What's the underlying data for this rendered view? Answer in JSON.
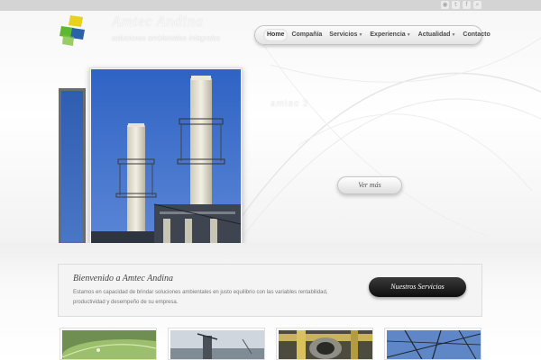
{
  "brand": {
    "name": "Amtec Andina",
    "tagline": "soluciones ambientales integrales"
  },
  "topbar": {
    "icons": [
      "rss-icon",
      "twitter-icon",
      "facebook-icon",
      "search-icon"
    ]
  },
  "nav": {
    "items": [
      {
        "label": "Home",
        "active": true,
        "dropdown": false
      },
      {
        "label": "Compañía",
        "active": false,
        "dropdown": false
      },
      {
        "label": "Servicios",
        "active": false,
        "dropdown": true
      },
      {
        "label": "Experiencia",
        "active": false,
        "dropdown": true
      },
      {
        "label": "Actualidad",
        "active": false,
        "dropdown": true
      },
      {
        "label": "Contacto",
        "active": false,
        "dropdown": false
      }
    ]
  },
  "slider": {
    "caption": "amtec 2",
    "more_label": "Ver más"
  },
  "welcome": {
    "title": "Bienvenido a Amtec Andina",
    "text": "Estamos en capacidad de brindar soluciones ambientales en justo equilibrio con las variables rentabilidad, productividad y desempeño de su empresa.",
    "button_label": "Nuestros Servicios"
  },
  "colors": {
    "sky": "#3f6fce",
    "button_dark": "#111111",
    "logo_yellow": "#e8d21e",
    "logo_green": "#5cb82e",
    "logo_blue": "#2a63a8"
  }
}
